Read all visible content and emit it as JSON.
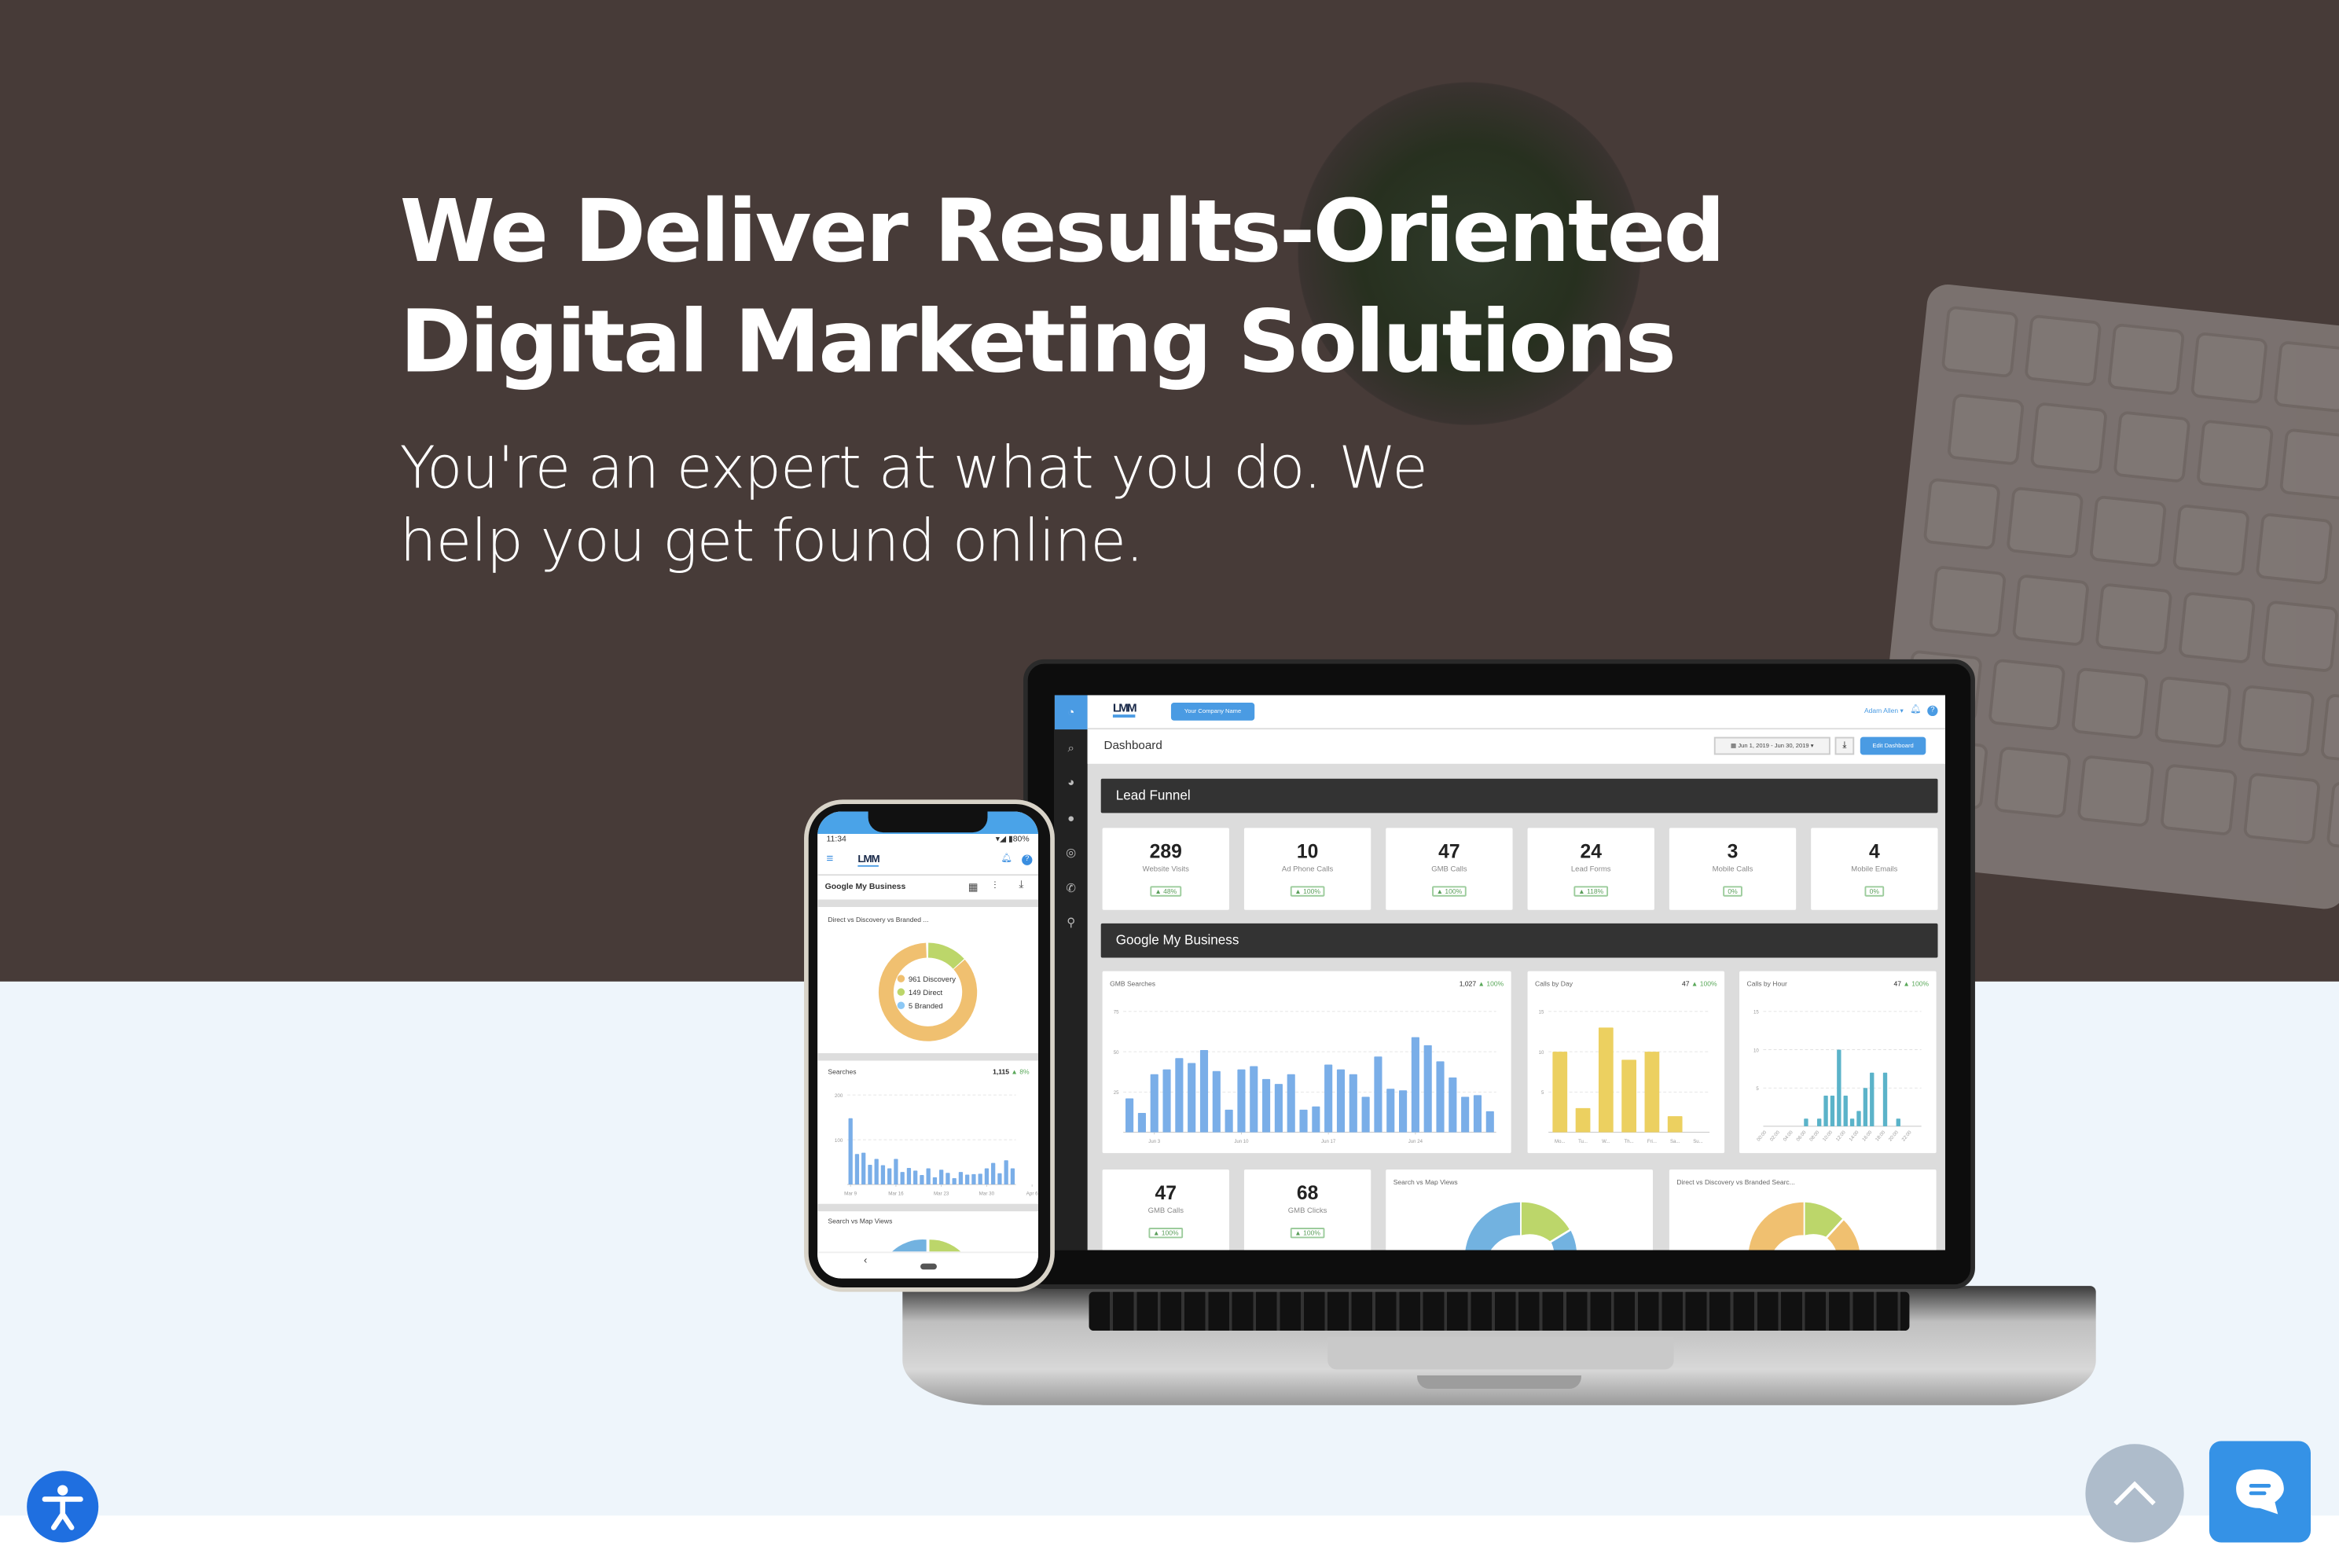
{
  "hero": {
    "headline_line1": "We Deliver Results-Oriented",
    "headline_line2": "Digital Marketing Solutions",
    "subtitle": "You're an expert at what you do. We help you get found online."
  },
  "colors": {
    "hero_bg": "#473b38",
    "accent_blue": "#4a9be3",
    "bar_blue": "#7aaee8",
    "bar_yellow": "#ecd060",
    "bar_teal": "#5bb3c9",
    "positive_green": "#5aa85a",
    "donut_orange": "#f0c070",
    "donut_green": "#bcd66a",
    "donut_blue": "#72b2e0"
  },
  "dashboard": {
    "logo": "LMM",
    "company_button": "Your Company Name",
    "user": "Adam Allen ▾",
    "title": "Dashboard",
    "date_range": "Jun 1, 2019 - Jun 30, 2019 ▾",
    "edit_button": "Edit Dashboard",
    "sidebar_icons": [
      "dashboard-icon",
      "search-icon",
      "pie-chart-icon",
      "chat-icon",
      "target-icon",
      "phone-icon",
      "map-pin-icon"
    ],
    "lead_funnel_title": "Lead Funnel",
    "kpis": [
      {
        "value": "289",
        "label": "Website Visits",
        "change": "▲ 48%"
      },
      {
        "value": "10",
        "label": "Ad Phone Calls",
        "change": "▲ 100%"
      },
      {
        "value": "47",
        "label": "GMB Calls",
        "change": "▲ 100%"
      },
      {
        "value": "24",
        "label": "Lead Forms",
        "change": "▲ 118%"
      },
      {
        "value": "3",
        "label": "Mobile Calls",
        "change": "0%"
      },
      {
        "value": "4",
        "label": "Mobile Emails",
        "change": "0%"
      }
    ],
    "gmb_title": "Google My Business",
    "gmb_kpis": [
      {
        "value": "47",
        "label": "GMB Calls",
        "change": "▲ 100%"
      },
      {
        "value": "68",
        "label": "GMB Clicks",
        "change": "▲ 100%"
      }
    ],
    "donut_titles": [
      "Search vs Map Views",
      "Direct vs Discovery vs Branded Searc..."
    ]
  },
  "mobile": {
    "time": "11:34",
    "battery": "80%",
    "logo": "LMM",
    "section_title": "Google My Business",
    "donut_title": "Direct vs Discovery vs Branded ...",
    "searches_bottom_title": "Search vs Map Views"
  },
  "chart_data": [
    {
      "type": "bar",
      "title": "GMB Searches",
      "total": "1,027",
      "change": "▲ 100%",
      "ylim": [
        0,
        75
      ],
      "yticks": [
        "25",
        "50",
        "75"
      ],
      "xticklabels": [
        "Jun 3",
        "Jun 10",
        "Jun 17",
        "Jun 24"
      ],
      "color": "#7aaee8",
      "values": [
        21,
        12,
        36,
        39,
        46,
        43,
        51,
        38,
        14,
        39,
        41,
        33,
        30,
        36,
        14,
        16,
        42,
        39,
        36,
        22,
        47,
        27,
        26,
        59,
        54,
        44,
        34,
        22,
        23,
        13
      ]
    },
    {
      "type": "bar",
      "title": "Calls by Day",
      "total": "47",
      "change": "▲ 100%",
      "ylim": [
        0,
        15
      ],
      "yticks": [
        "5",
        "10",
        "15"
      ],
      "categories": [
        "Mo...",
        "Tu...",
        "W...",
        "Th...",
        "Fri...",
        "Sa...",
        "Su..."
      ],
      "color": "#ecd060",
      "values": [
        10,
        3,
        13,
        9,
        10,
        2,
        0
      ]
    },
    {
      "type": "bar",
      "title": "Calls by Hour",
      "total": "47",
      "change": "▲ 100%",
      "ylim": [
        0,
        15
      ],
      "yticks": [
        "5",
        "10",
        "15"
      ],
      "categories": [
        "00:00",
        "01:00",
        "02:00",
        "03:00",
        "04:00",
        "05:00",
        "06:00",
        "07:00",
        "08:00",
        "09:00",
        "10:00",
        "11:00",
        "12:00",
        "13:00",
        "14:00",
        "15:00",
        "16:00",
        "17:00",
        "18:00",
        "19:00",
        "20:00",
        "21:00",
        "22:00",
        "23:00"
      ],
      "xticklabels": [
        "00:00",
        "02:00",
        "04:00",
        "06:00",
        "08:00",
        "10:00",
        "12:00",
        "14:00",
        "16:00",
        "18:00",
        "20:00",
        "22:00"
      ],
      "color": "#5bb3c9",
      "values": [
        0,
        0,
        0,
        0,
        0,
        0,
        1,
        0,
        1,
        4,
        4,
        10,
        4,
        1,
        2,
        5,
        7,
        0,
        7,
        0,
        1,
        0,
        0,
        0
      ]
    },
    {
      "type": "bar",
      "title": "Searches",
      "total": "1,115",
      "change": "▲ 8%",
      "ylim": [
        0,
        200
      ],
      "yticks": [
        "100",
        "200"
      ],
      "xticklabels": [
        "Mar 9",
        "Mar 16",
        "Mar 23",
        "Mar 30",
        "Apr 6"
      ],
      "color": "#7aaee8",
      "values": [
        148,
        68,
        71,
        44,
        57,
        43,
        36,
        57,
        28,
        37,
        31,
        21,
        36,
        16,
        33,
        26,
        14,
        28,
        22,
        23,
        24,
        36,
        48,
        25,
        54,
        36
      ]
    },
    {
      "type": "pie",
      "title": "Direct vs Discovery vs Branded ...",
      "slices": [
        {
          "label": "Discovery",
          "value": 961,
          "color": "#f0c070"
        },
        {
          "label": "Direct",
          "value": 149,
          "color": "#bcd66a"
        },
        {
          "label": "Branded",
          "value": 5,
          "color": "#8cc8f5"
        }
      ]
    }
  ]
}
